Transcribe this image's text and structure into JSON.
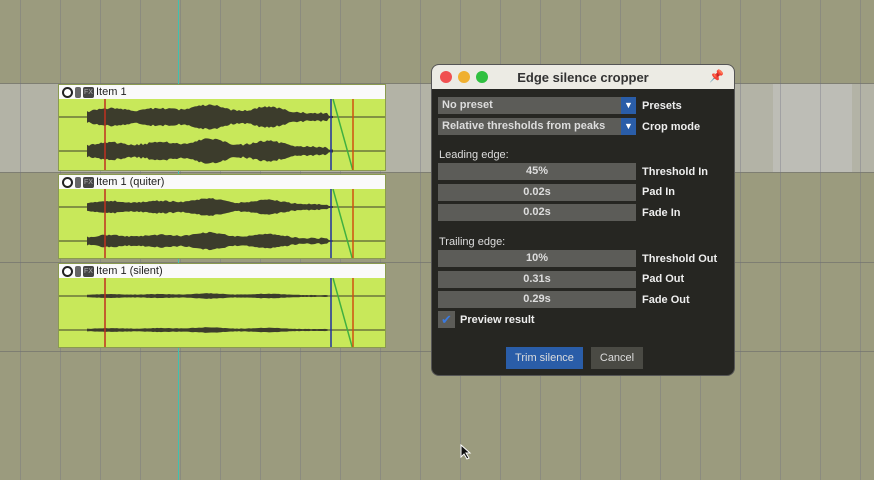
{
  "items": [
    {
      "title": "Item 1"
    },
    {
      "title": "Item 1 (quiter)"
    },
    {
      "title": "Item 1 (silent)"
    }
  ],
  "item_icons": [
    "volume-knob-icon",
    "lock-icon",
    "fx-icon"
  ],
  "item_fx_label": "FX",
  "dialog": {
    "title": "Edge silence cropper",
    "preset": {
      "value": "No preset",
      "label": "Presets"
    },
    "crop_mode": {
      "value": "Relative thresholds from peaks",
      "label": "Crop mode"
    },
    "leading_header": "Leading edge:",
    "leading": [
      {
        "value": "45%",
        "label": "Threshold In",
        "fraction": 0.45
      },
      {
        "value": "0.02s",
        "label": "Pad In"
      },
      {
        "value": "0.02s",
        "label": "Fade In"
      }
    ],
    "trailing_header": "Trailing edge:",
    "trailing": [
      {
        "value": "10%",
        "label": "Threshold Out",
        "fraction": 0.1
      },
      {
        "value": "0.31s",
        "label": "Pad Out"
      },
      {
        "value": "0.29s",
        "label": "Fade Out"
      }
    ],
    "preview_label": "Preview result",
    "preview_checked": true,
    "trim_label": "Trim silence",
    "cancel_label": "Cancel"
  },
  "colors": {
    "accent": "#2a5da8",
    "item": "#c8e85a",
    "wave": "#3c3c2c"
  }
}
